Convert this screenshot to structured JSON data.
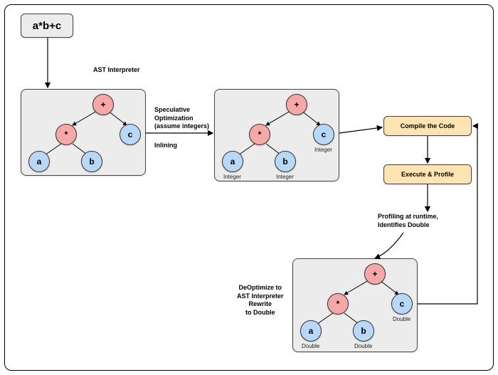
{
  "expression": "a*b+c",
  "labels": {
    "ast_interpreter": "AST Interpreter",
    "speculative": "Speculative\nOptimization\n(assume integers)",
    "inlining": "Inlining",
    "compile": "Compile the Code",
    "execute": "Execute & Profile",
    "profiling": "Profiling at runtime,\nIdentifies Double",
    "deoptimize": "DeOptimize to\nAST Interpreter\nRewrite\nto Double"
  },
  "nodes": {
    "plus": "+",
    "star": "*",
    "a": "a",
    "b": "b",
    "c": "c"
  },
  "types": {
    "integer": "Integer",
    "double": "Double"
  }
}
